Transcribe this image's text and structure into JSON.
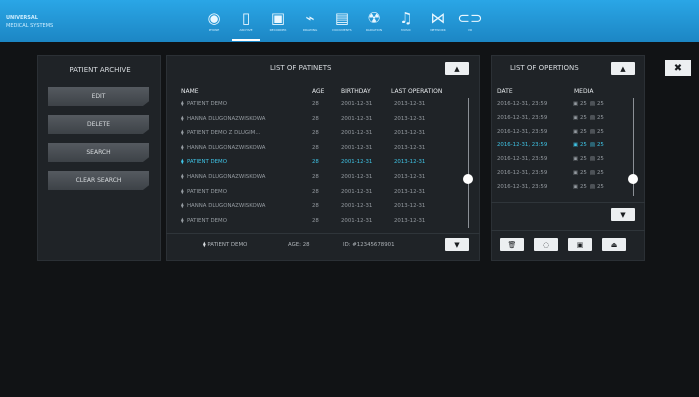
{
  "header": {
    "brand_line1": "UNIVERSAL",
    "brand_line2": "MEDICAL SYSTEMS",
    "nav": [
      {
        "icon": "microphone-icon",
        "glyph": "◉",
        "label": "PHONE",
        "active": false
      },
      {
        "icon": "patient-archive-icon",
        "glyph": "▯",
        "label": "ARCHIVE",
        "active": true
      },
      {
        "icon": "camera-icon",
        "glyph": "▣",
        "label": "RECORDER",
        "active": false
      },
      {
        "icon": "brush-icon",
        "glyph": "⌁",
        "label": "DRAWING",
        "active": false
      },
      {
        "icon": "document-icon",
        "glyph": "▤",
        "label": "DOCUMENTS",
        "active": false
      },
      {
        "icon": "radiation-icon",
        "glyph": "☢",
        "label": "RADIATION",
        "active": false
      },
      {
        "icon": "music-icon",
        "glyph": "♫",
        "label": "MUSIC",
        "active": false
      },
      {
        "icon": "network-icon",
        "glyph": "⋈",
        "label": "NETWORK",
        "active": false
      },
      {
        "icon": "glasses-icon",
        "glyph": "⊂⊃",
        "label": "VR",
        "active": false
      }
    ]
  },
  "archive": {
    "title": "PATIENT ARCHIVE",
    "buttons": [
      "EDIT",
      "DELETE",
      "SEARCH",
      "CLEAR SEARCH"
    ]
  },
  "patients": {
    "title": "LIST OF PATINETS",
    "up_glyph": "▲",
    "down_glyph": "▼",
    "columns": [
      "NAME",
      "AGE",
      "BIRTHDAY",
      "LAST OPERATION"
    ],
    "rows": [
      {
        "name": "PATIENT DEMO",
        "age": "28",
        "birthday": "2001-12-31",
        "last_op": "2013-12-31",
        "selected": false
      },
      {
        "name": "HANNA DLUGONAZWISKOWA",
        "age": "28",
        "birthday": "2001-12-31",
        "last_op": "2013-12-31",
        "selected": false
      },
      {
        "name": "PATIENT DEMO Z DLUGIM...",
        "age": "28",
        "birthday": "2001-12-31",
        "last_op": "2013-12-31",
        "selected": false
      },
      {
        "name": "HANNA DLUGONAZWISKOWA",
        "age": "28",
        "birthday": "2001-12-31",
        "last_op": "2013-12-31",
        "selected": false
      },
      {
        "name": "PATIENT DEMO",
        "age": "28",
        "birthday": "2001-12-31",
        "last_op": "2013-12-31",
        "selected": true
      },
      {
        "name": "HANNA DLUGONAZWISKOWA",
        "age": "28",
        "birthday": "2001-12-31",
        "last_op": "2013-12-31",
        "selected": false
      },
      {
        "name": "PATIENT DEMO",
        "age": "28",
        "birthday": "2001-12-31",
        "last_op": "2013-12-31",
        "selected": false
      },
      {
        "name": "HANNA DLUGONAZWISKOWA",
        "age": "28",
        "birthday": "2001-12-31",
        "last_op": "2013-12-31",
        "selected": false
      },
      {
        "name": "PATIENT DEMO",
        "age": "28",
        "birthday": "2001-12-31",
        "last_op": "2013-12-31",
        "selected": false
      }
    ],
    "footer_name": "PATIENT DEMO",
    "footer_age": "AGE: 28",
    "footer_id": "ID: #12345678901"
  },
  "operations": {
    "title": "LIST OF OPERTIONS",
    "up_glyph": "▲",
    "down_glyph": "▼",
    "columns": [
      "DATE",
      "MEDIA"
    ],
    "rows": [
      {
        "date": "2016-12-31, 23:59",
        "photos": "25",
        "videos": "25",
        "selected": false
      },
      {
        "date": "2016-12-31, 23:59",
        "photos": "25",
        "videos": "25",
        "selected": false
      },
      {
        "date": "2016-12-31, 23:59",
        "photos": "25",
        "videos": "25",
        "selected": false
      },
      {
        "date": "2016-12-31, 23:59",
        "photos": "25",
        "videos": "25",
        "selected": true
      },
      {
        "date": "2016-12-31, 23:59",
        "photos": "25",
        "videos": "25",
        "selected": false
      },
      {
        "date": "2016-12-31, 23:59",
        "photos": "25",
        "videos": "25",
        "selected": false
      },
      {
        "date": "2016-12-31, 23:59",
        "photos": "25",
        "videos": "25",
        "selected": false
      }
    ],
    "actions": [
      {
        "name": "trash-icon",
        "glyph": "🗑"
      },
      {
        "name": "comment-icon",
        "glyph": "◌"
      },
      {
        "name": "save-icon",
        "glyph": "▣"
      },
      {
        "name": "export-icon",
        "glyph": "⏏"
      }
    ]
  },
  "close_glyph": "✖"
}
